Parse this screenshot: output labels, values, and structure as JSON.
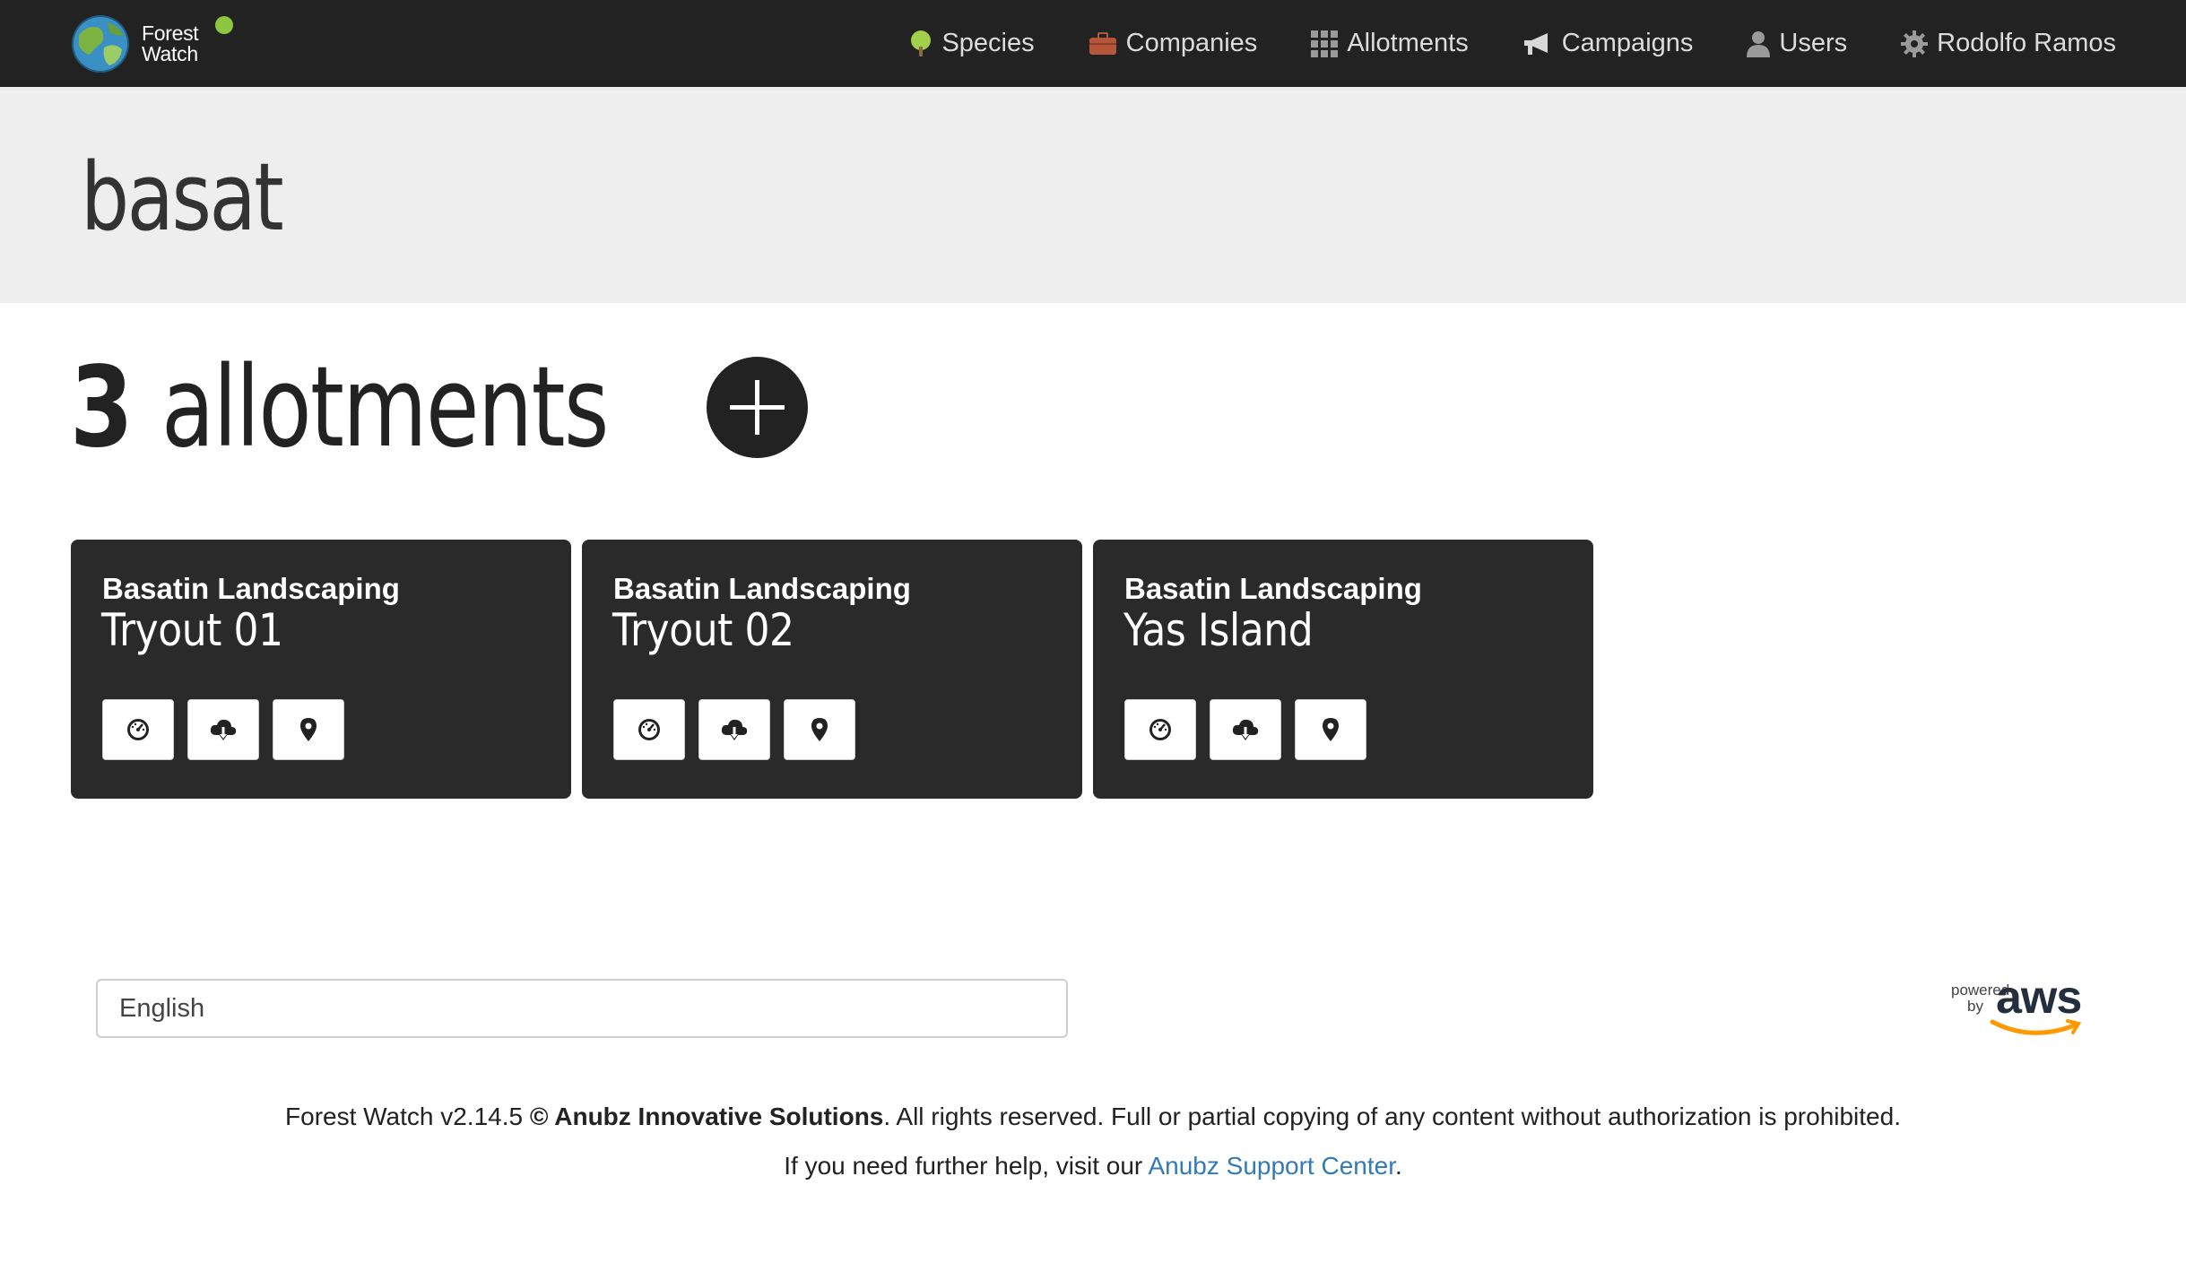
{
  "brand": {
    "line1": "Forest",
    "line2": "Watch",
    "status_color": "#8cc63f"
  },
  "nav": [
    {
      "label": "Species",
      "icon": "tree-icon"
    },
    {
      "label": "Companies",
      "icon": "briefcase-icon"
    },
    {
      "label": "Allotments",
      "icon": "grid-icon"
    },
    {
      "label": "Campaigns",
      "icon": "megaphone-icon"
    },
    {
      "label": "Users",
      "icon": "user-icon"
    },
    {
      "label": "Rodolfo Ramos",
      "icon": "gear-icon"
    }
  ],
  "page": {
    "title": "basat"
  },
  "allotments": {
    "count": "3",
    "label": "allotments"
  },
  "cards": [
    {
      "company": "Basatin Landscaping",
      "name": "Tryout 01"
    },
    {
      "company": "Basatin Landscaping",
      "name": "Tryout 02"
    },
    {
      "company": "Basatin Landscaping",
      "name": "Yas Island"
    }
  ],
  "footer": {
    "language": "English",
    "aws_powered": "powered",
    "aws_by": "by",
    "aws_word": "aws",
    "version_prefix": "Forest Watch v2.14.5 ",
    "company": "© Anubz Innovative Solutions",
    "rights": ". All rights reserved. Full or partial copying of any content without authorization is prohibited.",
    "help_prefix": "If you need further help, visit our ",
    "help_link": "Anubz Support Center",
    "help_suffix": "."
  }
}
